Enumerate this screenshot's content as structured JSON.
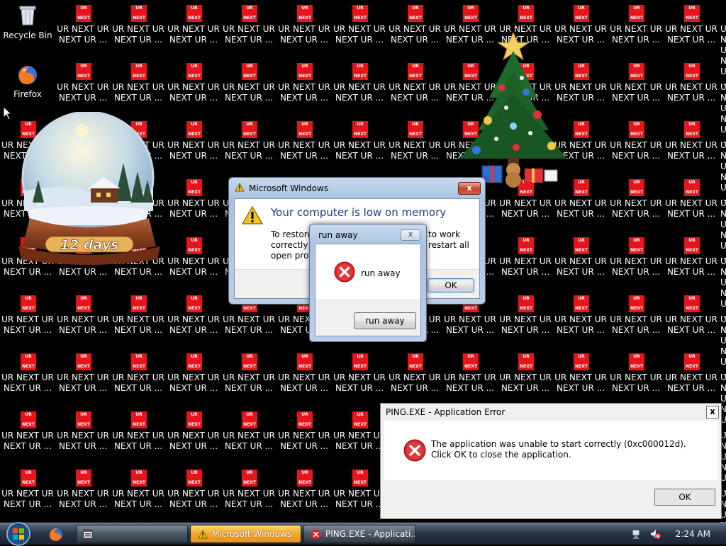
{
  "desktop": {
    "system_icons": [
      {
        "label": "Recycle Bin"
      },
      {
        "label": "Firefox"
      }
    ],
    "tile_icon": {
      "line1": "UR",
      "line2": "NEXT"
    },
    "repeated_icon_label": "UR NEXT UR NEXT UR ...",
    "gadgets": {
      "snow_globe_caption": "12 days"
    }
  },
  "dialogs": {
    "memory": {
      "title": "Microsoft Windows",
      "heading": "Your computer is low on memory",
      "body_left": "To restore",
      "body_left_2": "correctly, s",
      "body_left_3": "open prog",
      "body_right": "to work",
      "body_right_2": "restart all",
      "ok_label": "OK",
      "close_label": "x"
    },
    "runaway": {
      "title": "run away",
      "message": "run away",
      "button_label": "run away",
      "close_label": "x"
    },
    "ping": {
      "title": "PING.EXE - Application Error",
      "message": "The application was unable to start correctly (0xc000012d). Click OK to close the application.",
      "ok_label": "OK",
      "close_label": "x"
    }
  },
  "taskbar": {
    "buttons": [
      {
        "label": "Microsoft Windows"
      },
      {
        "label": "PING.EXE - Applicati..."
      }
    ],
    "clock": "2:24 AM"
  },
  "colors": {
    "tile_red": "#e8141b",
    "heading_blue": "#1e3d8c",
    "error_red": "#d9262b"
  }
}
